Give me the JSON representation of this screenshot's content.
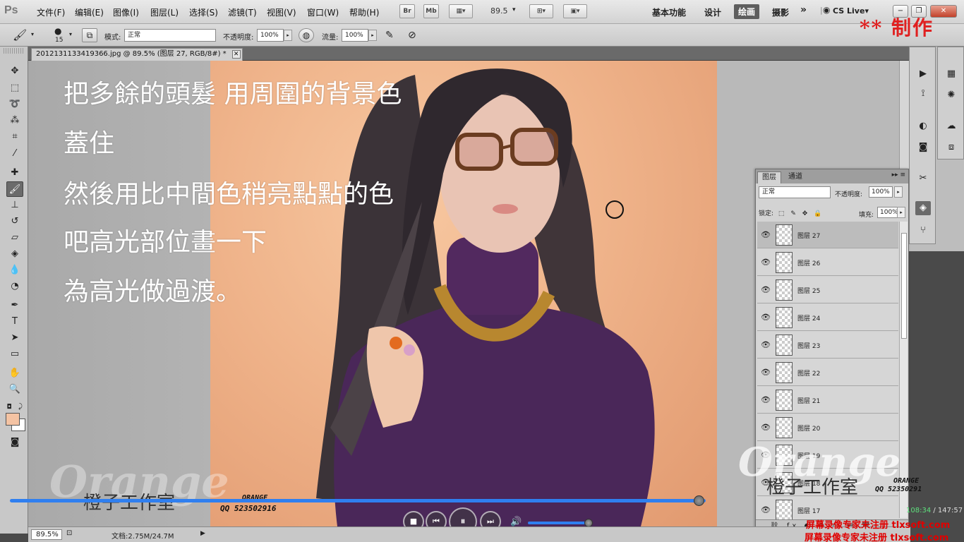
{
  "app": {
    "logo": "Ps"
  },
  "menu": [
    "文件(F)",
    "编辑(E)",
    "图像(I)",
    "图层(L)",
    "选择(S)",
    "滤镜(T)",
    "视图(V)",
    "窗口(W)",
    "帮助(H)"
  ],
  "menubar": {
    "br_label": "Br",
    "mb_label": "Mb",
    "zoom": "89.5",
    "workspaces": [
      "基本功能",
      "设计",
      "绘画",
      "摄影"
    ],
    "more": "»",
    "cs_live": "CS Live▾",
    "win_min": "−",
    "win_max": "❐",
    "win_close": "✕"
  },
  "maker_badge": "** 制作",
  "options": {
    "brush_size": "15",
    "mode_label": "模式:",
    "mode_value": "正常",
    "opacity_label": "不透明度:",
    "opacity_value": "100%",
    "flow_label": "流量:",
    "flow_value": "100%"
  },
  "document": {
    "tab_title": "2012131133419366.jpg @ 89.5% (图层 27, RGB/8#) *",
    "tab_close": "✕"
  },
  "instructions": [
    "把多餘的頭髮 用周圍的背景色",
    "蓋住",
    "然後用比中間色稍亮點點的色",
    "吧高光部位畫一下",
    "為高光做過渡。"
  ],
  "watermarks": {
    "brand_big_left": "Orange",
    "brand_big_right": "Orange",
    "studio_left": "橙子工作室",
    "studio_right": "橙子工作室",
    "orange_small_left": "ORANGE",
    "qq_left": "QQ 523502916",
    "orange_small_right": "ORANGE",
    "qq_right": "QQ 52350291",
    "registration_1": "屏幕录像专家未注册 tlxsoft.com",
    "registration_2": "屏幕录像专家未注册 tlxsoft.com"
  },
  "player": {
    "progress": 0.99,
    "volume": 0.95,
    "time_current": "108:34",
    "time_separator": " / ",
    "time_total": "147:57",
    "btn_stop": "■",
    "btn_prev": "⏮",
    "btn_play": "⏸",
    "btn_next": "⏭",
    "volume_icon": "🔊"
  },
  "status": {
    "zoom": "89.5%",
    "doc_info": "文档:2.75M/24.7M",
    "arrow": "▶"
  },
  "layers_panel": {
    "tabs": [
      "图层",
      "通道"
    ],
    "menu": "▸▸ ≡",
    "blend_mode": "正常",
    "opacity_label": "不透明度:",
    "opacity_value": "100%",
    "lock_label": "锁定:",
    "fill_label": "填充:",
    "fill_value": "100%",
    "layers": [
      "图层 27",
      "图层 26",
      "图层 25",
      "图层 24",
      "图层 23",
      "图层 22",
      "图层 21",
      "图层 20",
      "图层 19",
      "图层 18",
      "图层 17"
    ],
    "selected_index": 0,
    "bottom_icons": "⛓ fx ◐ ◍ ▭ ▤ 🗑"
  },
  "colors": {
    "foreground": "#f4c3a3",
    "background": "#ffffff",
    "accent": "#2f7ff0"
  }
}
